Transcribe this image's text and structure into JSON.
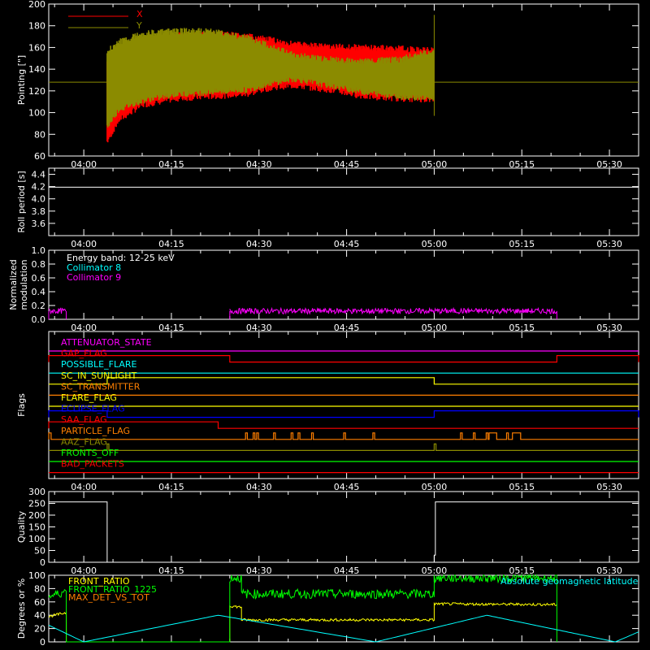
{
  "time_ticks": [
    "04:00",
    "04:15",
    "04:30",
    "04:45",
    "05:00",
    "05:15",
    "05:30"
  ],
  "time_range": {
    "start": "03:54",
    "end": "05:35",
    "start_min": 234,
    "end_min": 335
  },
  "colors": {
    "bg": "#000000",
    "axis": "#ffffff",
    "red": "#ff0000",
    "olive": "#8b8b00",
    "yellow": "#ffff00",
    "green": "#00ff00",
    "cyan": "#00ffff",
    "magenta": "#ff00ff",
    "orange": "#ff7f00",
    "blue": "#0000ff",
    "white": "#ffffff",
    "pink": "#ff00c8"
  },
  "chart_data": [
    {
      "type": "line",
      "ylabel": "Pointing [\"]",
      "ylim": [
        60,
        200
      ],
      "yticks": [
        60,
        80,
        100,
        120,
        140,
        160,
        180,
        200
      ],
      "legend": [
        "X",
        "Y"
      ],
      "series": [
        {
          "name": "X",
          "color": "red",
          "baseline_outside": 128,
          "envelope": {
            "x": [
              244,
              246,
              250,
              256,
              262,
              268,
              272,
              276,
              282,
              288,
              294,
              300
            ],
            "upper": [
              150,
              158,
              168,
              174,
              176,
              173,
              170,
              166,
              164,
              163,
              162,
              160
            ],
            "lower": [
              70,
              90,
              104,
              110,
              112,
              114,
              120,
              122,
              118,
              112,
              110,
              109
            ]
          }
        },
        {
          "name": "Y",
          "color": "olive",
          "baseline_outside": 128,
          "envelope": {
            "x": [
              244,
              246,
              250,
              256,
              262,
              268,
              272,
              276,
              282,
              288,
              294,
              300
            ],
            "upper": [
              160,
              168,
              176,
              178,
              178,
              172,
              164,
              156,
              152,
              150,
              152,
              160
            ],
            "lower": [
              84,
              100,
              108,
              114,
              116,
              118,
              124,
              128,
              122,
              116,
              112,
              110
            ]
          }
        }
      ]
    },
    {
      "type": "line",
      "ylabel": "Roll period [s]",
      "ylim": [
        3.4,
        4.5
      ],
      "yticks": [
        3.6,
        3.8,
        4.0,
        4.2,
        4.4
      ],
      "series": [
        {
          "color": "white",
          "x": [
            234,
            335
          ],
          "y": [
            4.19,
            4.19
          ]
        }
      ]
    },
    {
      "type": "line",
      "ylabel": "Normalized\nmodulation",
      "ylim": [
        0,
        1.0
      ],
      "yticks": [
        0.0,
        0.2,
        0.4,
        0.6,
        0.8,
        1.0
      ],
      "legend_title": "Energy band: 12-25 keV",
      "series": [
        {
          "name": "Collimator 8",
          "color": "cyan",
          "segments": []
        },
        {
          "name": "Collimator 9",
          "color": "magenta",
          "segments": [
            [
              234,
              237,
              0.12
            ],
            [
              265,
              321,
              0.12
            ]
          ]
        }
      ]
    },
    {
      "type": "flags",
      "ylabel": "Flags",
      "flags": [
        {
          "name": "ATTENUATOR_STATE",
          "color": "magenta",
          "on": []
        },
        {
          "name": "GAP_FLAG",
          "color": "red",
          "on": [
            [
              234,
              265
            ],
            [
              321,
              335
            ]
          ]
        },
        {
          "name": "POSSIBLE_FLARE",
          "color": "cyan",
          "on": []
        },
        {
          "name": "SC_IN_SUNLIGHT",
          "color": "yellow",
          "on": [
            [
              244,
              300
            ]
          ]
        },
        {
          "name": "SC_TRANSMITTER",
          "color": "orange",
          "on": []
        },
        {
          "name": "FLARE_FLAG",
          "color": "yellow",
          "on": []
        },
        {
          "name": "ECLIPSE_FLAG",
          "color": "blue",
          "on": [
            [
              234,
              244
            ],
            [
              300,
              335
            ]
          ]
        },
        {
          "name": "SAA_FLAG",
          "color": "red",
          "on": [
            [
              234,
              263
            ]
          ]
        },
        {
          "name": "PARTICLE_FLAG",
          "color": "orange",
          "on": [
            [
              234,
              234.4
            ],
            [
              267.7,
              268
            ],
            [
              269,
              269.3
            ],
            [
              269.6,
              269.9
            ],
            [
              272.5,
              272.8
            ],
            [
              275.5,
              275.8
            ],
            [
              276.7,
              277
            ],
            [
              279,
              279.3
            ],
            [
              284.5,
              284.8
            ],
            [
              289.5,
              289.8
            ],
            [
              304.5,
              304.8
            ],
            [
              306.7,
              307
            ],
            [
              308.9,
              309.2
            ],
            [
              309.4,
              310.7
            ],
            [
              312.4,
              312.7
            ],
            [
              313.4,
              314.8
            ]
          ]
        },
        {
          "name": "AAZ_FLAG",
          "color": "olive",
          "on": [
            [
              244,
              244.3
            ],
            [
              300,
              300.3
            ]
          ]
        },
        {
          "name": "FRONTS_OFF",
          "color": "green",
          "on": []
        },
        {
          "name": "BAD_PACKETS",
          "color": "red",
          "on": []
        }
      ]
    },
    {
      "type": "line",
      "ylabel": "Quality",
      "ylim": [
        0,
        300
      ],
      "yticks": [
        0,
        50,
        100,
        150,
        200,
        250,
        300
      ],
      "series": [
        {
          "color": "white",
          "x": [
            234,
            244,
            244,
            300,
            300,
            300.2,
            300.2,
            335
          ],
          "y": [
            256,
            256,
            0,
            0,
            30,
            30,
            256,
            256
          ]
        }
      ]
    },
    {
      "type": "line",
      "ylabel": "Degrees or %",
      "ylim": [
        0,
        100
      ],
      "yticks": [
        0,
        20,
        40,
        60,
        80,
        100
      ],
      "annotation": "Absolute geomagnetic latitude",
      "series": [
        {
          "name": "FRONT_RATIO",
          "color": "yellow",
          "x": [
            234,
            237,
            237,
            265,
            265,
            267,
            267,
            300,
            300,
            321
          ],
          "y": [
            38,
            44,
            0,
            0,
            54,
            52,
            33,
            33,
            57,
            56
          ]
        },
        {
          "name": "FRONT_RATIO_1225",
          "color": "green",
          "x": [
            234,
            237,
            237,
            265,
            265,
            267,
            267,
            300,
            300,
            321,
            321
          ],
          "y": [
            68,
            76,
            0,
            0,
            96,
            96,
            72,
            72,
            96,
            96,
            0
          ]
        },
        {
          "name": "MAX_DET_VS_TOT",
          "color": "orange",
          "x": [],
          "y": []
        },
        {
          "name": "Absolute geomagnetic latitude",
          "color": "cyan",
          "x": [
            234,
            240,
            263,
            290,
            309,
            331,
            335
          ],
          "y": [
            25,
            0,
            40,
            0,
            40,
            0,
            15
          ]
        }
      ]
    }
  ]
}
